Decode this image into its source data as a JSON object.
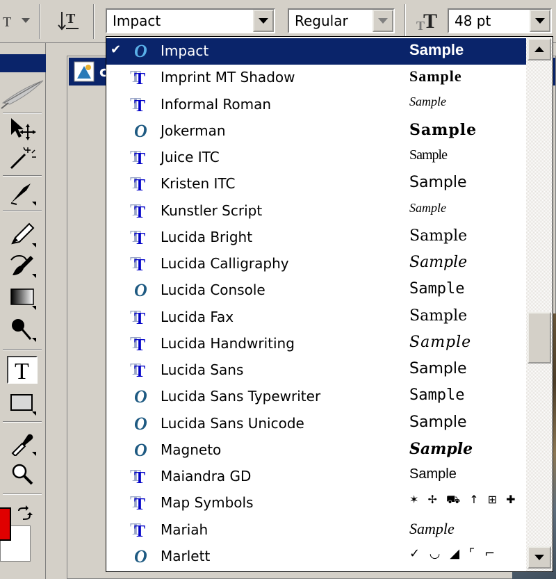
{
  "options_bar": {
    "font_family": "Impact",
    "font_style": "Regular",
    "font_size": "48 pt"
  },
  "document": {
    "title": "c"
  },
  "dropdown": {
    "selected": "Impact",
    "fonts": [
      {
        "name": "Impact",
        "icon": "opentype-icon",
        "sample": "Sample",
        "selected": true
      },
      {
        "name": "Imprint MT Shadow",
        "icon": "truetype-icon",
        "sample": "Sample"
      },
      {
        "name": "Informal Roman",
        "icon": "truetype-icon",
        "sample": "Sample"
      },
      {
        "name": "Jokerman",
        "icon": "opentype-icon",
        "sample": "Sample"
      },
      {
        "name": "Juice ITC",
        "icon": "truetype-icon",
        "sample": "Sample"
      },
      {
        "name": "Kristen ITC",
        "icon": "truetype-icon",
        "sample": "Sample"
      },
      {
        "name": "Kunstler Script",
        "icon": "truetype-icon",
        "sample": "Sample"
      },
      {
        "name": "Lucida Bright",
        "icon": "truetype-icon",
        "sample": "Sample"
      },
      {
        "name": "Lucida Calligraphy",
        "icon": "truetype-icon",
        "sample": "Sample"
      },
      {
        "name": "Lucida Console",
        "icon": "opentype-icon",
        "sample": "Sample"
      },
      {
        "name": "Lucida Fax",
        "icon": "truetype-icon",
        "sample": "Sample"
      },
      {
        "name": "Lucida Handwriting",
        "icon": "truetype-icon",
        "sample": "Sample"
      },
      {
        "name": "Lucida Sans",
        "icon": "truetype-icon",
        "sample": "Sample"
      },
      {
        "name": "Lucida Sans Typewriter",
        "icon": "opentype-icon",
        "sample": "Sample"
      },
      {
        "name": "Lucida Sans Unicode",
        "icon": "opentype-icon",
        "sample": "Sample"
      },
      {
        "name": "Magneto",
        "icon": "opentype-icon",
        "sample": "Sample"
      },
      {
        "name": "Maiandra GD",
        "icon": "truetype-icon",
        "sample": "Sample"
      },
      {
        "name": "Map Symbols",
        "icon": "truetype-icon",
        "sample": "✶ ✢ ⛟ ↑ ⊞ ✚"
      },
      {
        "name": "Mariah",
        "icon": "truetype-icon",
        "sample": "Sample"
      },
      {
        "name": "Marlett",
        "icon": "opentype-icon",
        "sample": "✓ ◡ ◢ ⌜ ⌐"
      }
    ]
  },
  "colors": {
    "selection": "#0a246a",
    "truetype_icon": "#0000c8",
    "opentype_icon": "#1e5a82",
    "foreground_color": "#e00000",
    "background_color": "#ffffff"
  }
}
